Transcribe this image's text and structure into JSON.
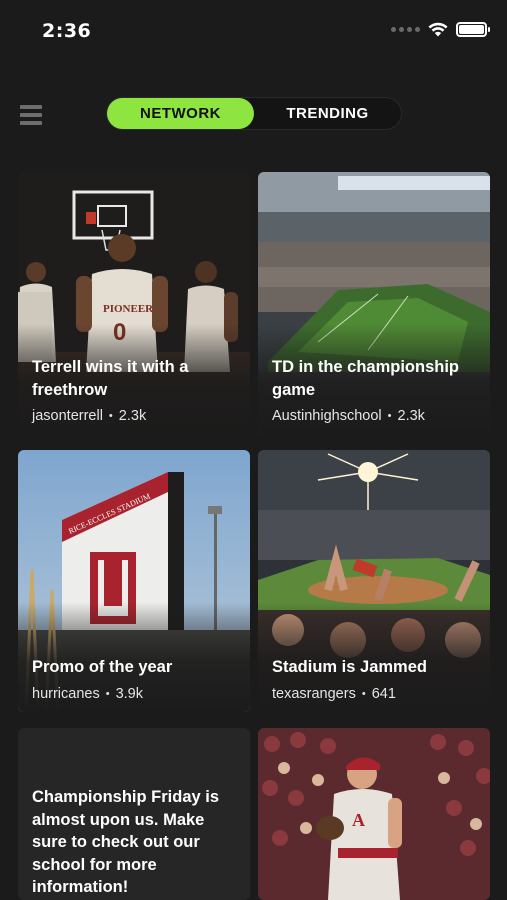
{
  "status_bar": {
    "time": "2:36"
  },
  "tabs": [
    {
      "label": "NETWORK",
      "active": true
    },
    {
      "label": "TRENDING",
      "active": false
    }
  ],
  "colors": {
    "accent": "#8ee53f",
    "background": "#1b1b1b"
  },
  "posts": [
    {
      "title": "Terrell wins it with a freethrow",
      "author": "jasonterrell",
      "views": "2.3k"
    },
    {
      "title": "TD in the championship game",
      "author": "Austinhighschool",
      "views": "2.3k"
    },
    {
      "title": "Promo of the year",
      "author": "hurricanes",
      "views": "3.9k"
    },
    {
      "title": "Stadium is Jammed",
      "author": "texasrangers",
      "views": "641"
    },
    {
      "text": "Championship Friday is almost upon us. Make sure to check out our school for more information!"
    }
  ],
  "images": {
    "post_0": "basketball-players",
    "post_1": "football-stadium",
    "post_2": "stadium-sign",
    "post_3": "baseball-stadium-crowd",
    "post_5": "baseball-pitcher"
  },
  "separator": "•"
}
